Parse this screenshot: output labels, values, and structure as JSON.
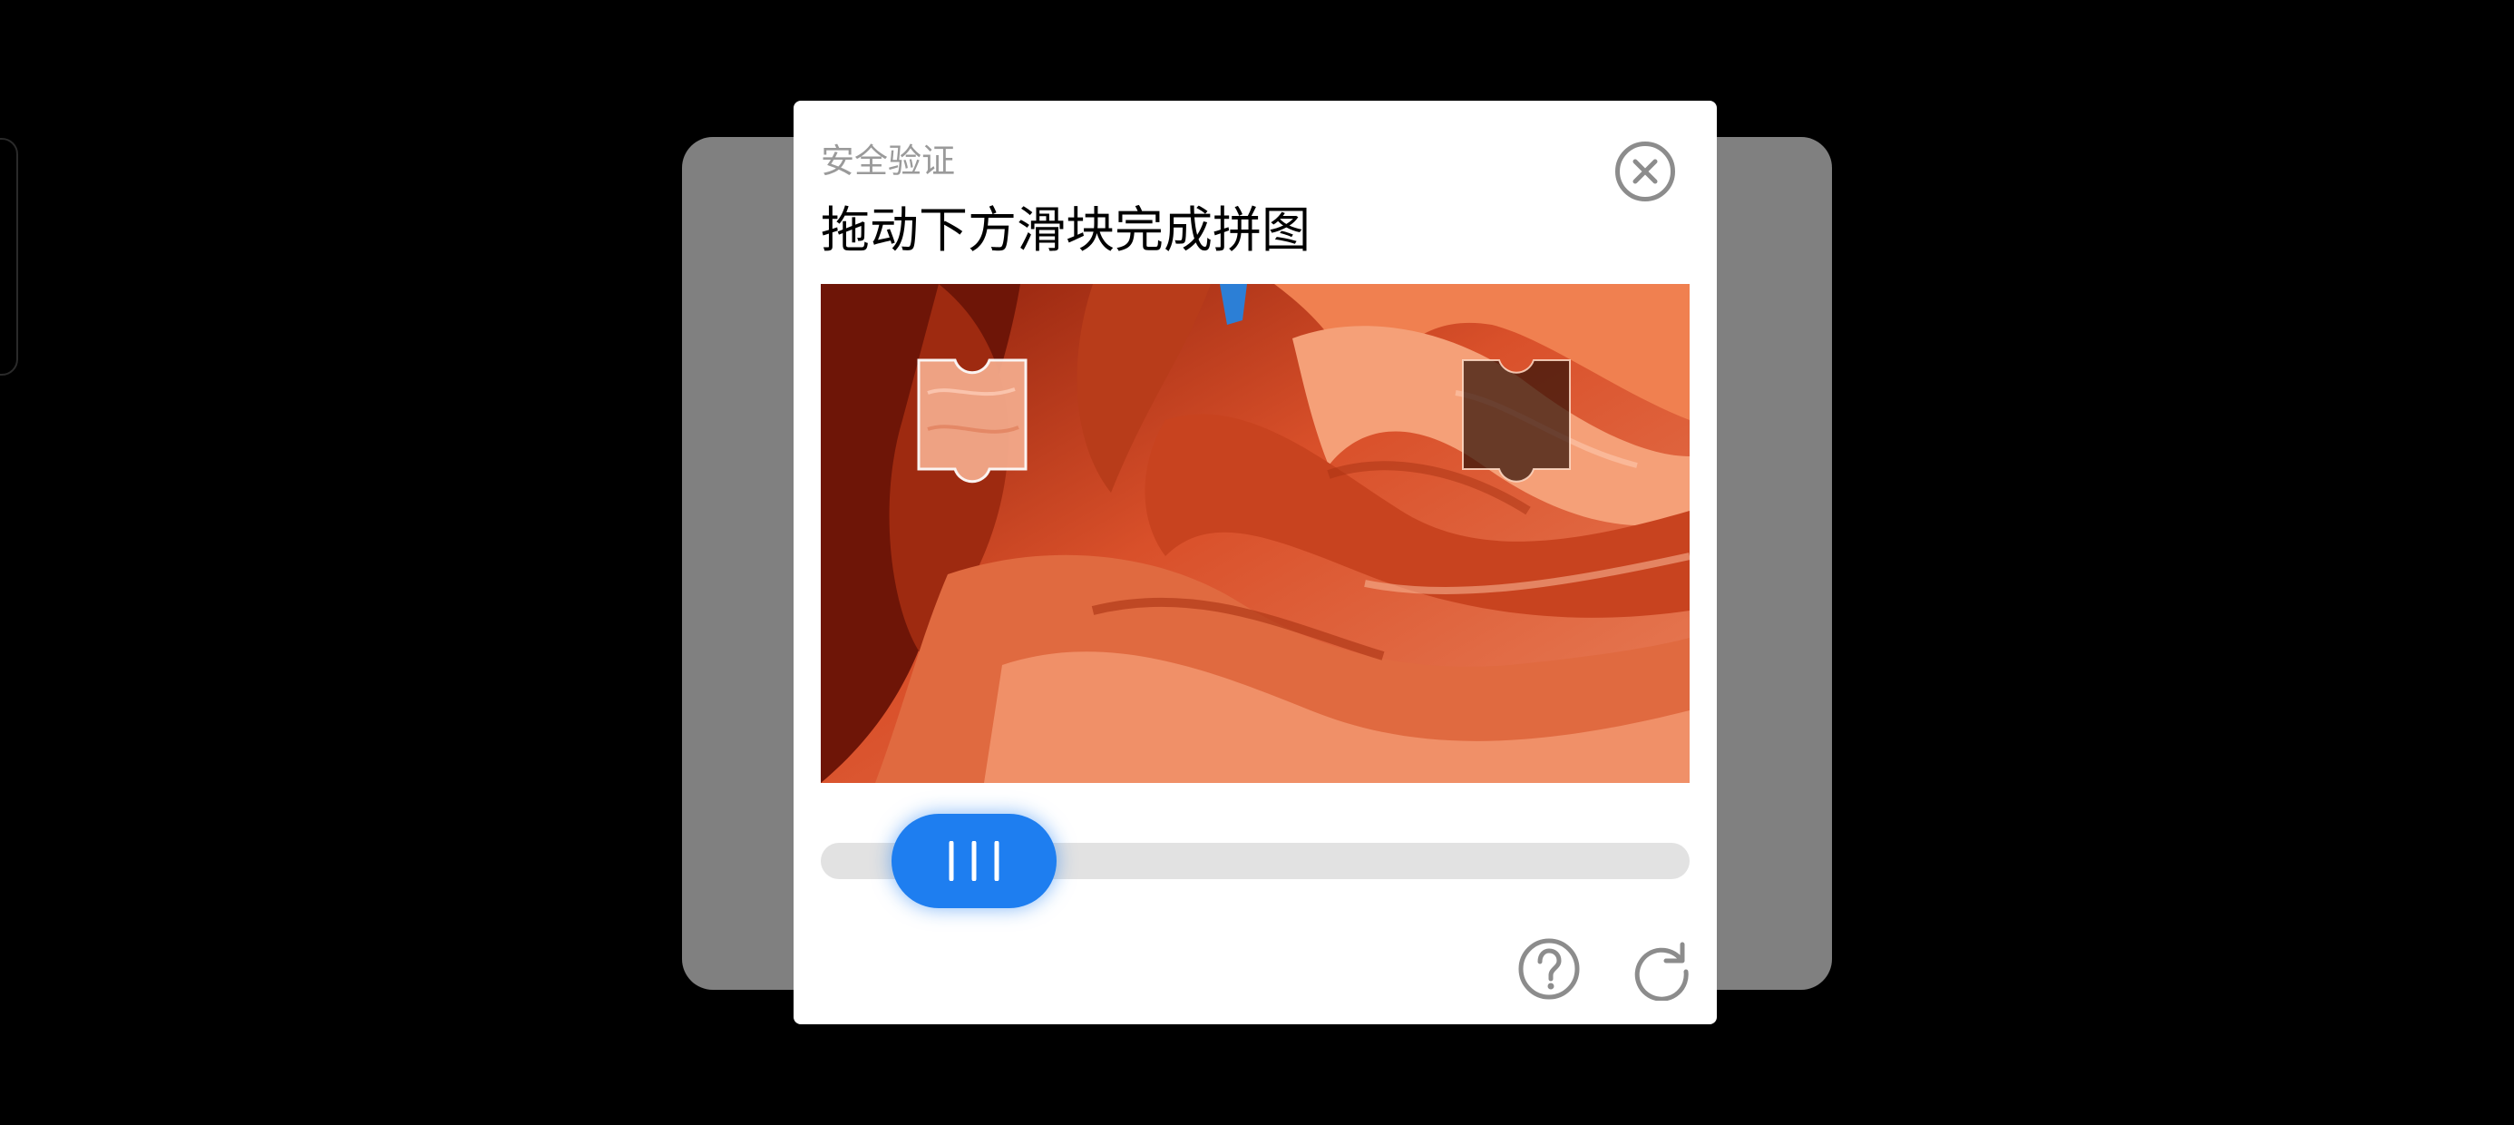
{
  "dialog": {
    "subtitle": "安全验证",
    "title": "拖动下方滑块完成拼图",
    "close_icon": "close-icon",
    "help_icon": "question-circle-icon",
    "refresh_icon": "refresh-icon"
  },
  "slider": {
    "grip_icon": "grip-lines-icon",
    "accent_color": "#1e7ef0",
    "track_color": "#e2e2e2"
  },
  "colors": {
    "backdrop": "#000000",
    "background_card": "#808080",
    "dialog": "#ffffff",
    "icon_gray": "#8c8c8c"
  }
}
